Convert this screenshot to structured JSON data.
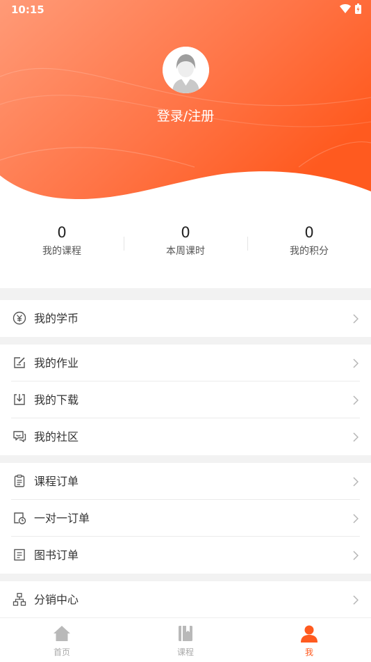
{
  "status_bar": {
    "time": "10:15"
  },
  "profile": {
    "login_text": "登录/注册"
  },
  "stats": [
    {
      "value": "0",
      "label": "我的课程"
    },
    {
      "value": "0",
      "label": "本周课时"
    },
    {
      "value": "0",
      "label": "我的积分"
    }
  ],
  "menu": {
    "coins": "我的学币",
    "homework": "我的作业",
    "downloads": "我的下载",
    "community": "我的社区",
    "course_orders": "课程订单",
    "one_on_one_orders": "一对一订单",
    "book_orders": "图书订单",
    "distribution": "分销中心"
  },
  "bottom_nav": {
    "home": "首页",
    "courses": "课程",
    "me": "我"
  },
  "colors": {
    "accent": "#ff5a1f",
    "header_light": "#ff9a77"
  }
}
